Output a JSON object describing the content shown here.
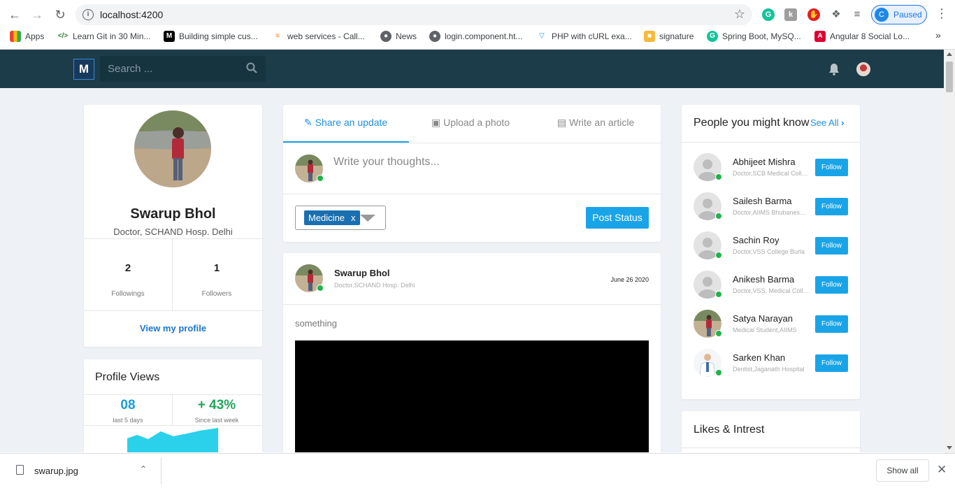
{
  "browser": {
    "url": "localhost:4200",
    "profile_initial": "C",
    "profile_status": "Paused",
    "bookmarks": [
      {
        "label": "Apps",
        "icon": "apps-grid-icon"
      },
      {
        "label": "Learn Git in 30 Min...",
        "icon": "code-icon"
      },
      {
        "label": "Building simple cus...",
        "icon": "medium-icon"
      },
      {
        "label": "web services - Call...",
        "icon": "stackoverflow-icon"
      },
      {
        "label": "News",
        "icon": "globe-icon"
      },
      {
        "label": "login.component.ht...",
        "icon": "globe-icon"
      },
      {
        "label": "PHP with cURL exa...",
        "icon": "php-icon"
      },
      {
        "label": "signature",
        "icon": "box-icon"
      },
      {
        "label": "Spring Boot, MySQ...",
        "icon": "grammarly-icon"
      },
      {
        "label": "Angular 8 Social Lo...",
        "icon": "angular-icon"
      }
    ],
    "bookmarks_more": "»"
  },
  "header": {
    "logo_letter": "M",
    "search_placeholder": "Search ..."
  },
  "profile": {
    "name": "Swarup Bhol",
    "title": "Doctor, SCHAND Hosp. Delhi",
    "followings_count": "2",
    "followings_label": "Followings",
    "followers_count": "1",
    "followers_label": "Followers",
    "view_profile": "View my profile"
  },
  "profile_views": {
    "title": "Profile Views",
    "left_value": "08",
    "left_label": "last 5 days",
    "right_value": "+ 43%",
    "right_label": "Since last week"
  },
  "composer": {
    "tabs": [
      "Share an update",
      "Upload a photo",
      "Write an article"
    ],
    "placeholder": "Write your thoughts...",
    "tag": "Medicine",
    "tag_remove": "x",
    "post_button": "Post Status"
  },
  "post": {
    "author": "Swarup Bhol",
    "subtitle": "Doctor,SCHAND Hosp. Delhi",
    "date": "June 26 2020",
    "text": "something"
  },
  "pymk": {
    "title": "People you might know",
    "see_all": "See All",
    "follow_label": "Follow",
    "people": [
      {
        "name": "Abhijeet Mishra",
        "sub": "Doctor,SCB Medical College"
      },
      {
        "name": "Sailesh Barma",
        "sub": "Doctor,AIIMS Bhubaneswar"
      },
      {
        "name": "Sachin Roy",
        "sub": "Doctor,VSS College Burla"
      },
      {
        "name": "Anikesh Barma",
        "sub": "Doctor,VSS, Medical College"
      },
      {
        "name": "Satya Narayan",
        "sub": "Medical Student,AIIMS"
      },
      {
        "name": "Sarken Khan",
        "sub": "Dentist,Jaganath Hospital"
      }
    ]
  },
  "likes": {
    "title": "Likes & Intrest"
  },
  "download_bar": {
    "file": "swarup.jpg",
    "show_all": "Show all"
  },
  "colors": {
    "header_bg": "#1d3c4a",
    "accent": "#1aa4e8",
    "link": "#1d8ee5",
    "online": "#22b14c",
    "views_left": "#1a9bd7",
    "views_right": "#1fa65a"
  }
}
